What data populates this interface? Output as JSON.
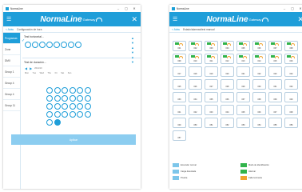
{
  "left_window": {
    "title": "NormaLine",
    "brand": "NormaLine",
    "brand_suffix": "Gateway",
    "breadcrumb": {
      "back": "< Atrás",
      "title": "Configuración de hora"
    },
    "sidebar": [
      {
        "label": "Programas",
        "active": true
      },
      {
        "label": "Zone",
        "active": false
      },
      {
        "label": "DMX",
        "active": false
      },
      {
        "label": "Group 1",
        "active": false
      },
      {
        "label": "Group 4",
        "active": false
      },
      {
        "label": "Group 4",
        "active": false
      },
      {
        "label": "Group 11",
        "active": false
      }
    ],
    "section1_title": "Test horizontal...",
    "section2_title": "Test de duración...",
    "nav_label": "2014/10",
    "days": [
      "Mon",
      "Tue",
      "Wed",
      "Thu",
      "Fri",
      "Sat",
      "Sun"
    ],
    "apply_label": "Aplicar"
  },
  "right_window": {
    "title": "NormaLine",
    "brand": "NormaLine",
    "brand_suffix": "Gateway",
    "breadcrumb": {
      "back": "< Atrás",
      "title": "Estado/alarmas/test manual"
    },
    "tiles": [
      "001",
      "002",
      "003",
      "004",
      "005",
      "006",
      "007",
      "008",
      "009",
      "010",
      "011",
      "012",
      "013",
      "014",
      "015",
      "016",
      "017",
      "018",
      "019",
      "020",
      "021",
      "022",
      "023",
      "024",
      "025",
      "026",
      "027",
      "028",
      "029",
      "030",
      "031",
      "032",
      "033",
      "034",
      "035",
      "036",
      "037",
      "038",
      "039",
      "040",
      "041",
      "042",
      "043",
      "044",
      "045",
      "046",
      "047",
      "048",
      "049",
      "050",
      "051",
      "052",
      "053",
      "054",
      "055",
      "056",
      "057"
    ],
    "legend": [
      {
        "label": "Encender normal",
        "color": "#7dc6ea"
      },
      {
        "label": "Modo de identificación",
        "color": "#31b34b"
      },
      {
        "label": "Carga detectada",
        "color": "#7dc6ea"
      },
      {
        "label": "Alarmar",
        "color": "#31b34b"
      },
      {
        "label": "Prueba",
        "color": "#7dc6ea"
      },
      {
        "label": "Falla luminaria",
        "color": "#f0a32e"
      }
    ]
  },
  "colors": {
    "accent": "#1f9ed9",
    "ok": "#31b34b",
    "warn": "#f0a32e"
  }
}
